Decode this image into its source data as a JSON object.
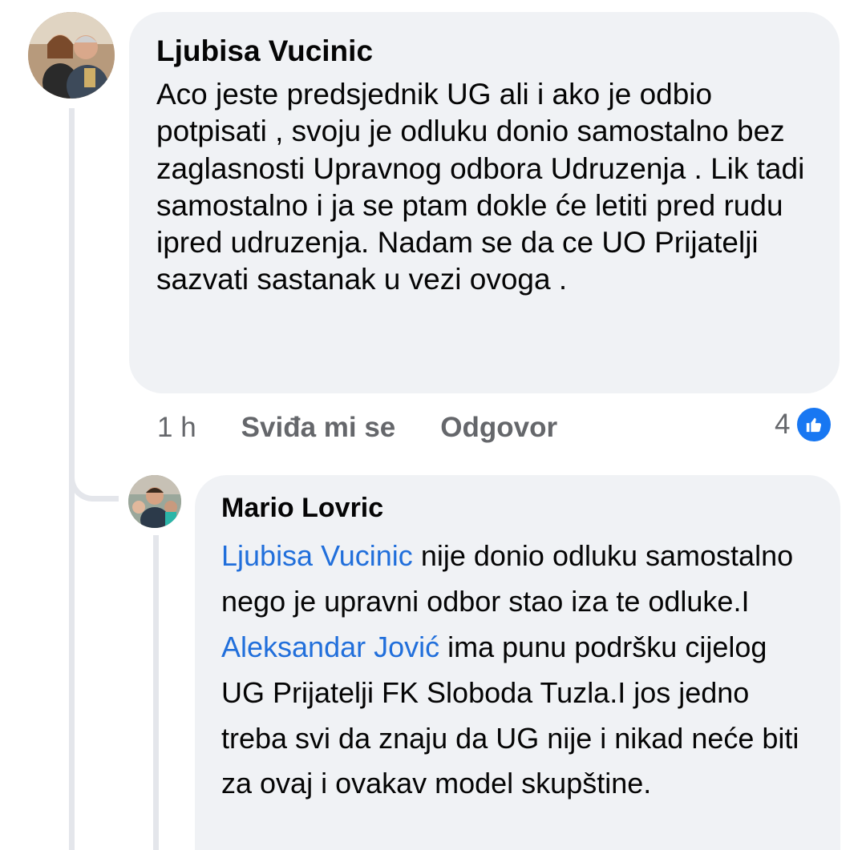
{
  "comments": [
    {
      "author": "Ljubisa Vucinic",
      "text": "Aco jeste  predsjednik UG ali i ako je odbio potpisati , svoju je odluku donio samostalno bez zaglasnosti Upravnog odbora Udruzenja . Lik tadi samostalno i ja se ptam dokle će letiti pred rudu ipred udruzenja. Nadam se da ce UO Prijatelji sazvati sastanak u vezi ovoga .",
      "time": "1 h",
      "like_label": "Sviđa mi se",
      "reply_label": "Odgovor",
      "reaction_count": "4",
      "reaction_icon": "thumbs-up-icon"
    },
    {
      "author": "Mario Lovric",
      "mention_1": "Ljubisa Vucinic",
      "text_1": " nije donio odluku samostalno nego je upravni odbor stao iza te odluke.I ",
      "mention_2": "Aleksandar Jović",
      "text_2": " ima punu podršku cijelog UG Prijatelji FK Sloboda Tuzla.I jos jedno treba svi da znaju da UG nije i nikad neće biti za ovaj i ovakav model skupštine."
    }
  ],
  "colors": {
    "bubble_bg": "#f0f2f5",
    "mention": "#216fdb",
    "meta_text": "#65676b",
    "like_blue": "#1877f2",
    "thread_line": "#e4e6eb"
  }
}
